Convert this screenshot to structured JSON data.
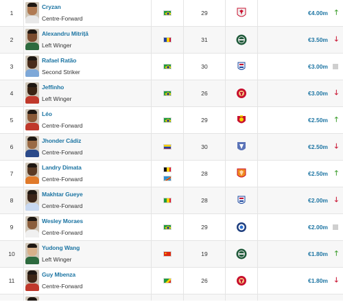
{
  "players": [
    {
      "rank": "1",
      "name": "Cryzan",
      "position": "Centre-Forward",
      "nationality": [
        "brazil-flag"
      ],
      "age": "29",
      "club": "red-eagle-crest-icon",
      "market_value": "€4.00m",
      "trend": "up"
    },
    {
      "rank": "2",
      "name": "Alexandru Mitriță",
      "position": "Left Winger",
      "nationality": [
        "romania-flag"
      ],
      "age": "31",
      "club": "green-round-crest-icon",
      "market_value": "€3.50m",
      "trend": "down"
    },
    {
      "rank": "3",
      "name": "Rafael Ratão",
      "position": "Second Striker",
      "nationality": [
        "brazil-flag"
      ],
      "age": "30",
      "club": "blue-red-crest-icon",
      "market_value": "€3.00m",
      "trend": "same"
    },
    {
      "rank": "4",
      "name": "Jeffinho",
      "position": "Left Winger",
      "nationality": [
        "brazil-flag"
      ],
      "age": "26",
      "club": "red-round-crest-icon",
      "market_value": "€3.00m",
      "trend": "down"
    },
    {
      "rank": "5",
      "name": "Léo",
      "position": "Centre-Forward",
      "nationality": [
        "brazil-flag"
      ],
      "age": "29",
      "club": "red-shield-crest-icon",
      "market_value": "€2.50m",
      "trend": "up"
    },
    {
      "rank": "6",
      "name": "Jhonder Cádiz",
      "position": "Centre-Forward",
      "nationality": [
        "venezuela-flag"
      ],
      "age": "30",
      "club": "blue-shield-crest-icon",
      "market_value": "€2.50m",
      "trend": "down"
    },
    {
      "rank": "7",
      "name": "Landry Dimata",
      "position": "Centre-Forward",
      "nationality": [
        "belgium-flag",
        "dr-congo-flag"
      ],
      "age": "28",
      "club": "orange-shield-crest-icon",
      "market_value": "€2.50m",
      "trend": "up"
    },
    {
      "rank": "8",
      "name": "Makhtar Gueye",
      "position": "Centre-Forward",
      "nationality": [
        "senegal-flag"
      ],
      "age": "28",
      "club": "blue-red-crest-icon",
      "market_value": "€2.00m",
      "trend": "down"
    },
    {
      "rank": "9",
      "name": "Wesley Moraes",
      "position": "Centre-Forward",
      "nationality": [
        "brazil-flag"
      ],
      "age": "29",
      "club": "blue-round-crest-icon",
      "market_value": "€2.00m",
      "trend": "same"
    },
    {
      "rank": "10",
      "name": "Yudong Wang",
      "position": "Left Winger",
      "nationality": [
        "china-flag"
      ],
      "age": "19",
      "club": "green-round-crest-icon",
      "market_value": "€1.80m",
      "trend": "up"
    },
    {
      "rank": "11",
      "name": "Guy Mbenza",
      "position": "Centre-Forward",
      "nationality": [
        "congo-flag"
      ],
      "age": "26",
      "club": "red-round-crest-icon",
      "market_value": "€1.80m",
      "trend": "down"
    }
  ],
  "trend_symbols": {
    "up": "🡑",
    "down": "🡓"
  },
  "colors": {
    "link": "#1d75a3",
    "up": "#3f9f2f",
    "down": "#c8102e",
    "neutral": "#cfcfcf"
  }
}
